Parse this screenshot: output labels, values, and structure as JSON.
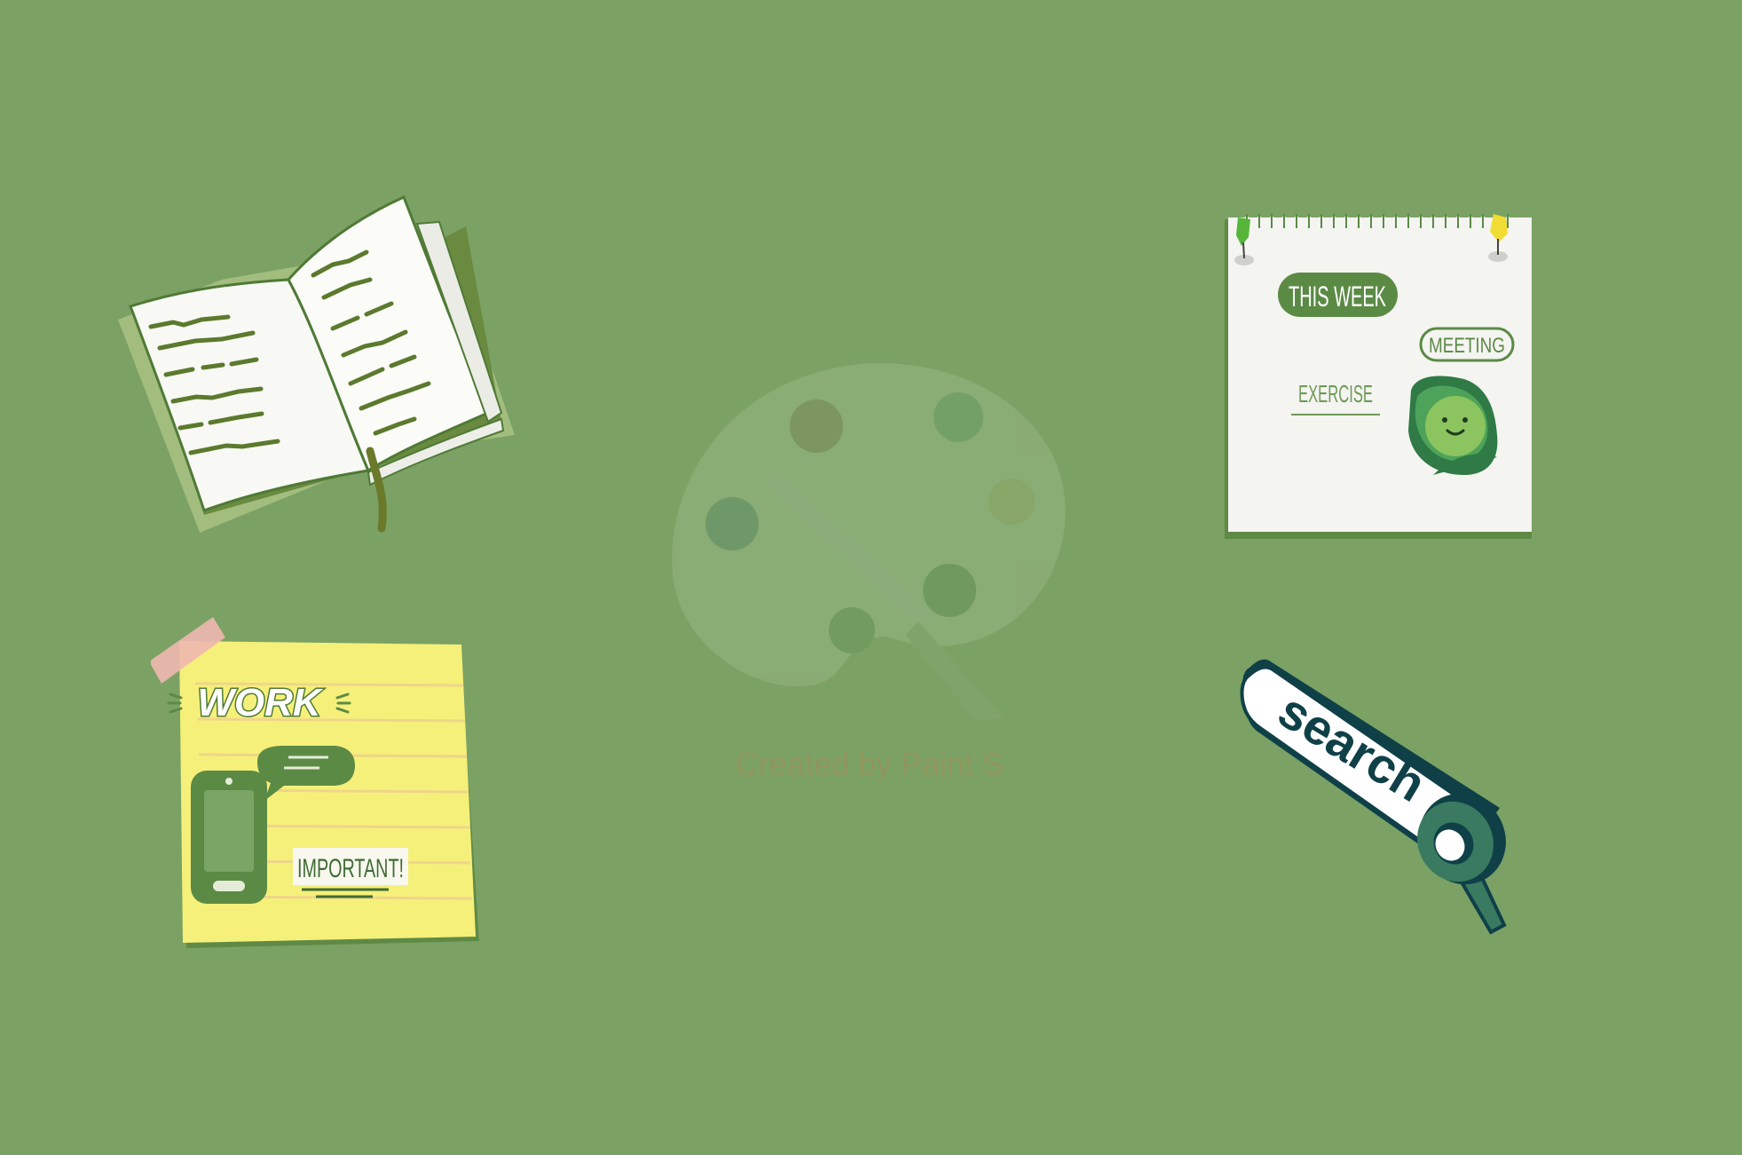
{
  "desktop": {
    "background_color": "#7ba264",
    "widgets": {
      "notebook": {
        "icon": "open-notebook-icon"
      },
      "sticky_note": {
        "icon": "sticky-note-icon",
        "header": "WORK",
        "stamp": "IMPORTANT!"
      },
      "weekly_planner": {
        "icon": "notepad-icon",
        "title": "THIS WEEK",
        "tags": [
          "MEETING",
          "EXERCISE"
        ]
      },
      "search": {
        "icon": "magnifier-icon",
        "label": "search"
      }
    }
  },
  "watermark": {
    "icon": "paint-palette-icon",
    "text": "Created by Paint S"
  },
  "colors": {
    "dark_green": "#3f6b34",
    "mid_green": "#5b8a45",
    "paper": "#f7f7f2",
    "sticky_yellow": "#f5f07a",
    "search_navy": "#0f4048"
  }
}
